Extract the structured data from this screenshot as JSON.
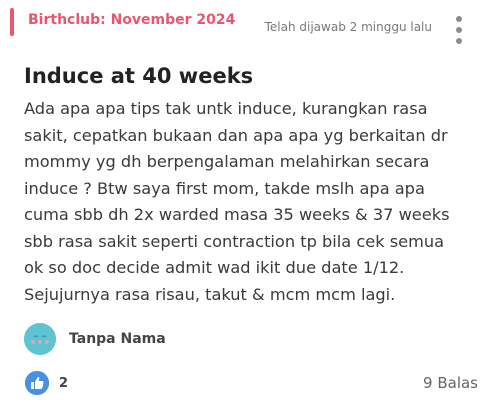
{
  "post": {
    "group_label": "Birthclub: November 2024",
    "answered_time": "Telah dijawab 2 minggu lalu",
    "title": "Induce at 40 weeks",
    "body_lines": [
      "Ada apa apa tips tak untk induce, kurangkan rasa",
      "sakit, cepatkan bukaan dan apa apa yg berkaitan dr",
      "mommy yg dh berpengalaman melahirkan secara",
      "induce ? Btw saya first mom, takde mslh apa apa",
      "cuma sbb dh 2x warded masa 35 weeks & 37 weeks",
      "sbb rasa sakit seperti contraction tp bila cek semua",
      "ok so doc decide admit wad ikit due date 1/12.",
      "Sejujurnya rasa risau, takut & mcm mcm lagi."
    ],
    "author": {
      "name": "Tanpa Nama",
      "avatar_icon": "anonymous-avatar-icon"
    },
    "likes": "2",
    "replies_label": "9 Balas",
    "menu_icon": "more-vertical-icon",
    "like_icon": "thumbs-up-icon"
  },
  "colors": {
    "accent": "#e8576b",
    "like_blue": "#4a90e2",
    "avatar_teal": "#5ec4d1"
  }
}
